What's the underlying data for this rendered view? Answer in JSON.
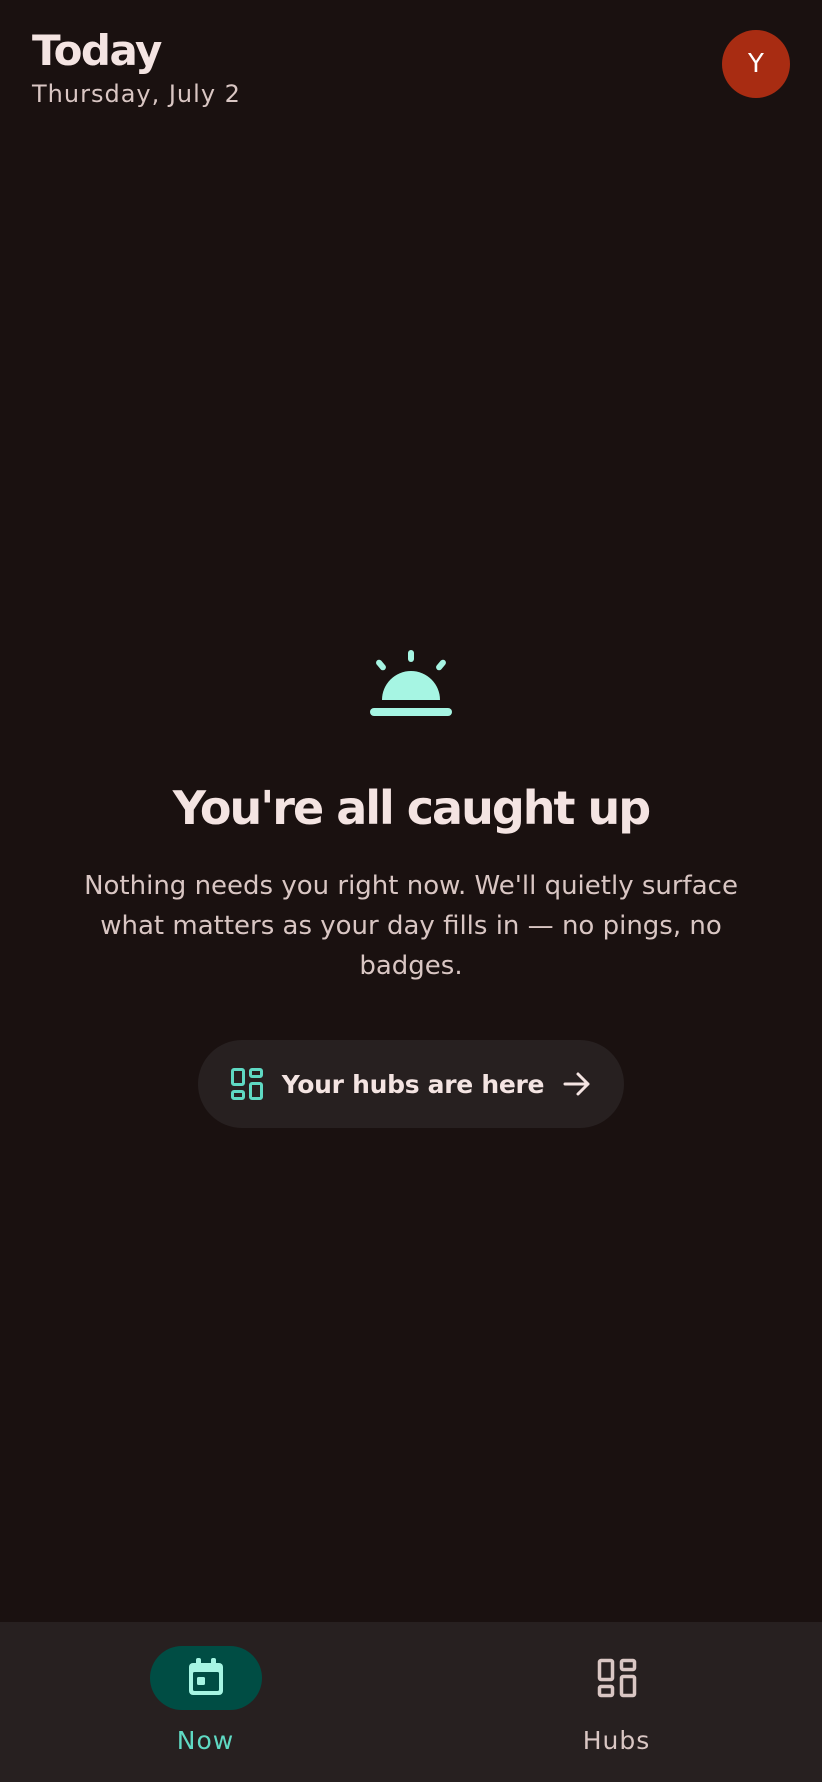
{
  "header": {
    "title": "Today",
    "date": "Thursday, July 2",
    "avatar_initial": "Y"
  },
  "empty_state": {
    "icon": "service-bell-icon",
    "title": "You're all caught up",
    "body": "Nothing needs you right now. We'll quietly surface what matters as your day fills in — no pings, no badges.",
    "button_label": "Your hubs are here",
    "button_icon": "dashboard-grid-icon",
    "button_trailing_icon": "arrow-right-icon"
  },
  "bottom_nav": {
    "items": [
      {
        "label": "Now",
        "icon": "calendar-icon",
        "active": true
      },
      {
        "label": "Hubs",
        "icon": "dashboard-grid-icon",
        "active": false
      }
    ]
  },
  "colors": {
    "background": "#1a1110",
    "surface": "#272020",
    "accent": "#5fd9c3",
    "accent_icon": "#a6f5e3",
    "active_pill": "#004d44",
    "avatar": "#a82c12",
    "text_primary": "#f4e4e2",
    "text_secondary": "#d9c6c3"
  }
}
